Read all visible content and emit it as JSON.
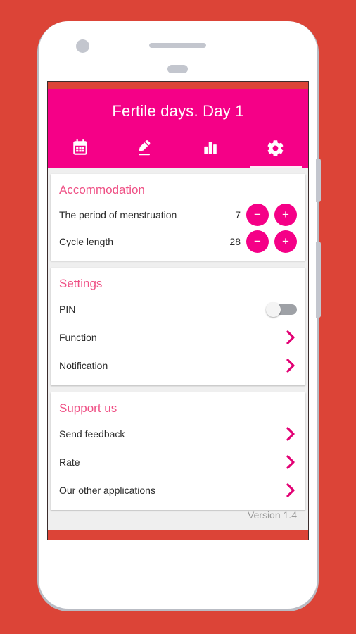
{
  "theme": {
    "background_red": "#dc4437",
    "accent_pink": "#f50087",
    "section_title_pink": "#ef5085",
    "chevron_pink": "#e20074",
    "screen_background": "#efefef",
    "card_background": "#ffffff"
  },
  "app": {
    "title": "Fertile days. Day 1"
  },
  "tabs": [
    {
      "id": "calendar",
      "icon": "calendar-icon",
      "active": false
    },
    {
      "id": "notes",
      "icon": "pencil-icon",
      "active": false
    },
    {
      "id": "stats",
      "icon": "bar-chart-icon",
      "active": false
    },
    {
      "id": "settings",
      "icon": "gear-icon",
      "active": true
    }
  ],
  "cards": {
    "accommodation": {
      "title": "Accommodation",
      "rows": [
        {
          "label": "The period of menstruation",
          "value": "7",
          "minus": "−",
          "plus": "+"
        },
        {
          "label": "Cycle length",
          "value": "28",
          "minus": "−",
          "plus": "+"
        }
      ]
    },
    "settings": {
      "title": "Settings",
      "pin": {
        "label": "PIN",
        "state": "off"
      },
      "rows": [
        {
          "label": "Function"
        },
        {
          "label": "Notification"
        }
      ]
    },
    "support": {
      "title": "Support us",
      "rows": [
        {
          "label": "Send feedback"
        },
        {
          "label": "Rate"
        },
        {
          "label": "Our other applications"
        }
      ]
    }
  },
  "footer": {
    "version": "Version 1.4"
  }
}
